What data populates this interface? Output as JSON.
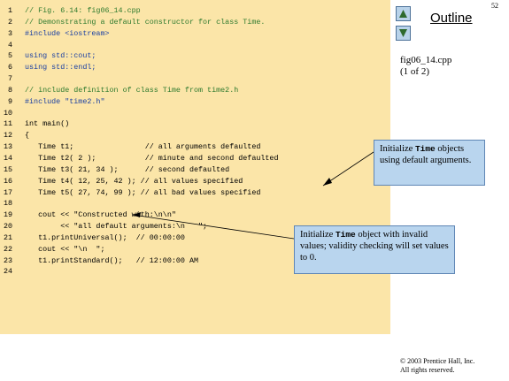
{
  "page_number": "52",
  "outline": {
    "title": "Outline"
  },
  "file_label": {
    "name": "fig06_14.cpp",
    "part": "(1 of 2)"
  },
  "code_lines": [
    {
      "num": "1",
      "text": "// Fig. 6.14: fig06_14.cpp",
      "kind": "comment"
    },
    {
      "num": "2",
      "text": "// Demonstrating a default constructor for class Time.",
      "kind": "comment"
    },
    {
      "num": "3",
      "text": "#include <iostream>",
      "kind": "directive"
    },
    {
      "num": "4",
      "text": "",
      "kind": "normal"
    },
    {
      "num": "5",
      "text": "using std::cout;",
      "kind": "directive"
    },
    {
      "num": "6",
      "text": "using std::endl;",
      "kind": "directive"
    },
    {
      "num": "7",
      "text": "",
      "kind": "normal"
    },
    {
      "num": "8",
      "text": "// include definition of class Time from time2.h",
      "kind": "comment"
    },
    {
      "num": "9",
      "text": "#include \"time2.h\"",
      "kind": "directive"
    },
    {
      "num": "10",
      "text": "",
      "kind": "normal"
    },
    {
      "num": "11",
      "text": "int main()",
      "kind": "normal"
    },
    {
      "num": "12",
      "text": "{",
      "kind": "normal"
    },
    {
      "num": "13",
      "text": "   Time t1;                // all arguments defaulted",
      "kind": "normal"
    },
    {
      "num": "14",
      "text": "   Time t2( 2 );           // minute and second defaulted",
      "kind": "normal"
    },
    {
      "num": "15",
      "text": "   Time t3( 21, 34 );      // second defaulted",
      "kind": "normal"
    },
    {
      "num": "16",
      "text": "   Time t4( 12, 25, 42 ); // all values specified",
      "kind": "normal"
    },
    {
      "num": "17",
      "text": "   Time t5( 27, 74, 99 ); // all bad values specified",
      "kind": "normal"
    },
    {
      "num": "18",
      "text": "",
      "kind": "normal"
    },
    {
      "num": "19",
      "text": "   cout << \"Constructed with:\\n\\n\"",
      "kind": "normal"
    },
    {
      "num": "20",
      "text": "        << \"all default arguments:\\n   \";",
      "kind": "normal"
    },
    {
      "num": "21",
      "text": "   t1.printUniversal();  // 00:00:00",
      "kind": "normal"
    },
    {
      "num": "22",
      "text": "   cout << \"\\n  \";",
      "kind": "normal"
    },
    {
      "num": "23",
      "text": "   t1.printStandard();   // 12:00:00 AM",
      "kind": "normal"
    },
    {
      "num": "24",
      "text": "",
      "kind": "normal"
    }
  ],
  "callout_1": {
    "prefix": "Initialize ",
    "code": "Time",
    "rest": " objects using default arguments."
  },
  "callout_2": {
    "prefix": "Initialize ",
    "code": "Time",
    "rest": " object with invalid values; validity checking will set values to 0."
  },
  "copyright": {
    "line1": "© 2003 Prentice Hall, Inc.",
    "line2": "All rights reserved."
  },
  "colors": {
    "code_background": "#fbe5a8",
    "callout_background": "#b9d5ee",
    "comment": "#2e7a2e",
    "directive": "#1a3fa3"
  },
  "icons": [
    "triangle-up-icon",
    "triangle-down-icon"
  ]
}
